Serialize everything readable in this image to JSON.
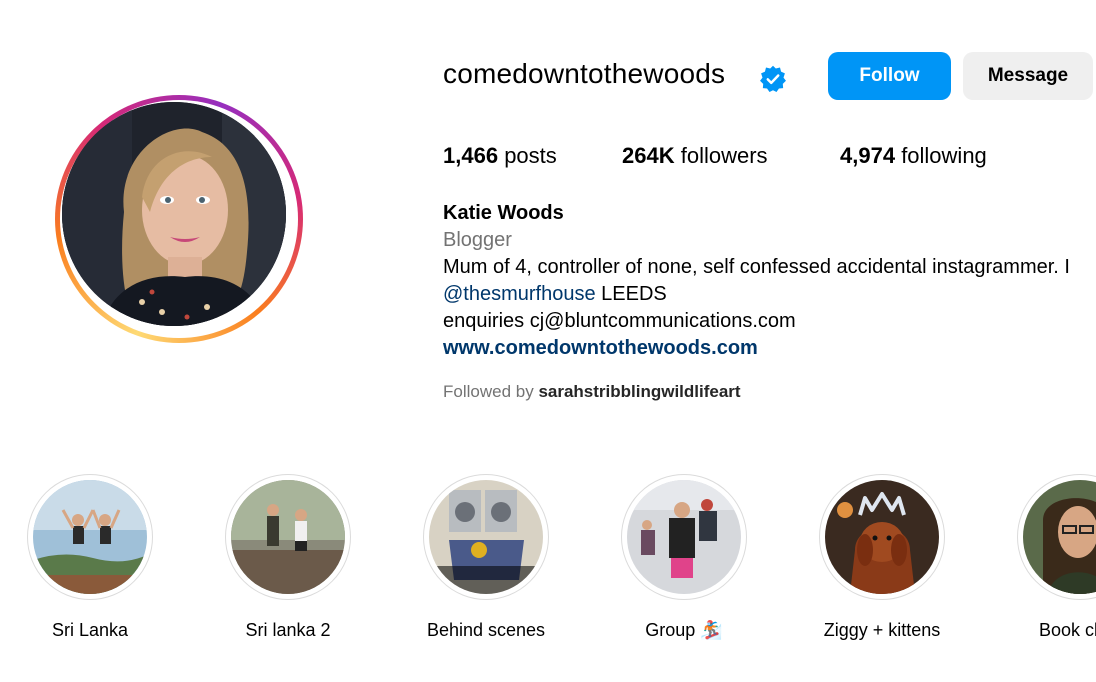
{
  "profile": {
    "username": "comedowntothewoods",
    "verified": true,
    "follow_label": "Follow",
    "message_label": "Message"
  },
  "stats": {
    "posts_count": "1,466",
    "posts_label": "posts",
    "followers_count": "264K",
    "followers_label": "followers",
    "following_count": "4,974",
    "following_label": "following"
  },
  "bio": {
    "name": "Katie Woods",
    "category": "Blogger",
    "line1": "Mum of 4, controller of none, self confessed accidental instagrammer. I",
    "mention": "@thesmurfhouse",
    "location": " LEEDS",
    "enquiries": "enquiries cj@bluntcommunications.com",
    "website": "www.comedowntothewoods.com",
    "followed_by_prefix": "Followed by ",
    "followed_by_user": "sarahstribblingwildlifeart"
  },
  "highlights": [
    {
      "label": "Sri Lanka"
    },
    {
      "label": "Sri lanka 2"
    },
    {
      "label": "Behind scenes"
    },
    {
      "label": "Group 🏂"
    },
    {
      "label": "Ziggy + kittens"
    },
    {
      "label": "Book cl"
    }
  ],
  "colors": {
    "accent": "#0095f6",
    "link": "#00376b",
    "muted": "#737373",
    "verified": "#0095f6"
  }
}
